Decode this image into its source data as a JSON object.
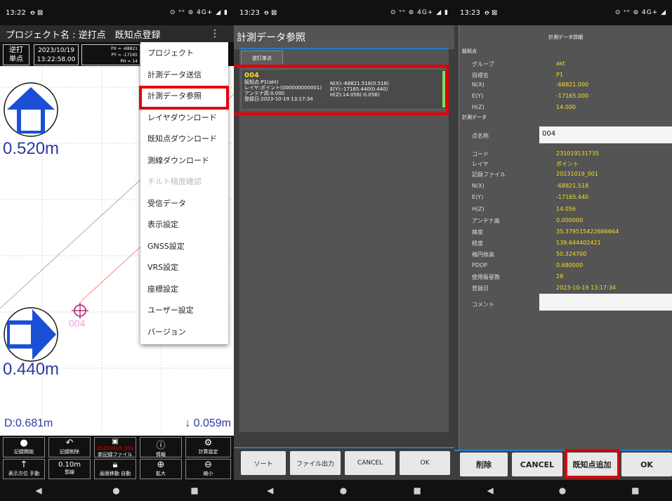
{
  "screen1": {
    "status": {
      "time": "13:22",
      "icons": "ꝋ ⊠",
      "right": "⊙ ᵛᵒ ⊚ 4G+ ◢ ▮"
    },
    "title": "プロジェクト名 : 逆打点　既知点登録",
    "mode_label_1": "逆打",
    "mode_label_2": "単点",
    "date": "2023/10/19",
    "time": "13:22:58.00",
    "px": "PX = -68821",
    "py": "PY = -17165",
    "ph": "PH = 14",
    "dist_top": "0.520m",
    "dist_bottom": "0.440m",
    "d_value": "D:0.681m",
    "down_value": "↓ 0.059m",
    "point_label": "004",
    "menu": [
      "プロジェクト",
      "計測データ送信",
      "計測データ参照",
      "レイヤダウンロード",
      "既知点ダウンロード",
      "測線ダウンロード",
      "チルト精度確認",
      "受信データ",
      "表示設定",
      "GNSS設定",
      "VRS設定",
      "座標設定",
      "ユーザー設定",
      "バージョン"
    ],
    "toolbar_row1": [
      "記録開始",
      "記録削除",
      "新記録ファイル",
      "情報",
      "計算設定"
    ],
    "toolbar_file": "20231019_001",
    "toolbar_row2": [
      "表示方位 手動",
      "罫線",
      "画面移動 自動",
      "拡大",
      "縮小"
    ],
    "scale": "0.10m"
  },
  "screen2": {
    "status": {
      "time": "13:23",
      "icons": "ꝋ ⊠",
      "right": "⊙ ᵛᵒ ⊚ 4G+ ◢ ▮"
    },
    "title": "計測データ参照",
    "tab": "逆打単点",
    "item": {
      "name": "004",
      "line1": "既知点:P1(akt)",
      "line2": "レイヤ:ポイント(000000000001)",
      "line3": "アンテナ高:0.000",
      "line4": "登録日:2023-10-19 13:17:34",
      "n": "N(X):-68821.518(0.518)",
      "e": "E(Y):-17165.440(0.440)",
      "h": "H(Z):14.056(-0.056)"
    },
    "buttons": [
      "ソート",
      "ファイル出力",
      "CANCEL",
      "OK"
    ]
  },
  "screen3": {
    "status": {
      "time": "13:23",
      "icons": "ꝋ ⊠",
      "right": "⊙ ᵛᵒ ⊚ 4G+ ◢"
    },
    "title": "計測データ詳細",
    "section1": "既知点",
    "known": [
      {
        "label": "グループ",
        "value": "akt"
      },
      {
        "label": "目標名",
        "value": "P1"
      },
      {
        "label": "N(X)",
        "value": "-68821.000"
      },
      {
        "label": "E(Y)",
        "value": "-17165.000"
      },
      {
        "label": "H(Z)",
        "value": "14.000"
      }
    ],
    "section2": "計測データ",
    "point_name_label": "点名称",
    "point_name_value": "004",
    "measured": [
      {
        "label": "コード",
        "value": "231019131735"
      },
      {
        "label": "レイヤ",
        "value": "ポイント"
      },
      {
        "label": "記録ファイル",
        "value": "20231019_001"
      },
      {
        "label": "N(X)",
        "value": "-68821.518"
      },
      {
        "label": "E(Y)",
        "value": "-17165.440"
      },
      {
        "label": "H(Z)",
        "value": "14.056"
      },
      {
        "label": "アンテナ高",
        "value": "0.000000"
      },
      {
        "label": "緯度",
        "value": "35.379515422666664"
      },
      {
        "label": "経度",
        "value": "139.644402421"
      },
      {
        "label": "楕円体高",
        "value": "50.324700"
      },
      {
        "label": "PDOP",
        "value": "0.680000"
      },
      {
        "label": "使用衛星数",
        "value": "28"
      },
      {
        "label": "登録日",
        "value": "2023-10-19 13:17:34"
      }
    ],
    "comment_label": "コメント",
    "buttons": [
      "削除",
      "CANCEL",
      "既知点追加",
      "OK"
    ]
  },
  "colors": {
    "highlight": "#e0000a",
    "accent": "#2979c8",
    "value": "#f6df25",
    "green": "#7ddc5c"
  }
}
